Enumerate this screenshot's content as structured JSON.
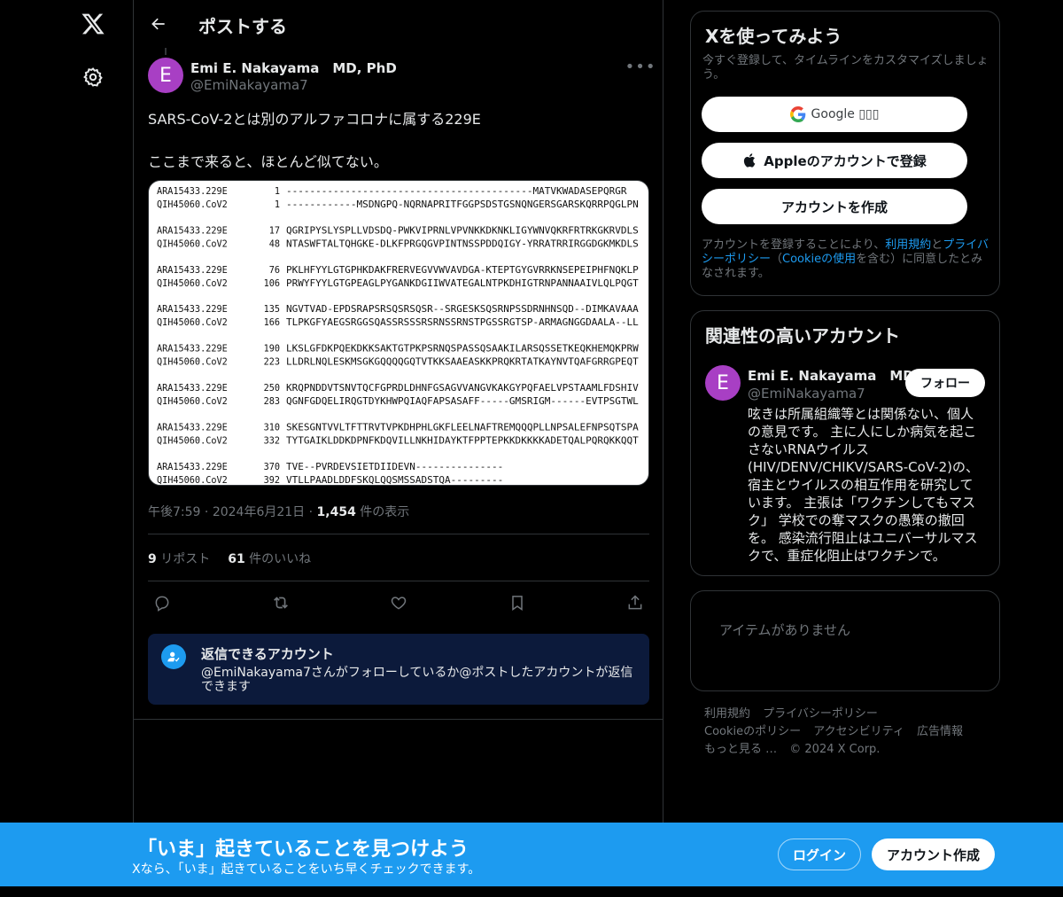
{
  "colors": {
    "accent": "#1d9bf0",
    "background": "#000000",
    "avatar": "#a83fc4",
    "reply_box": "#0c1a3b"
  },
  "nav": {
    "logo_icon": "x-logo-icon",
    "settings_icon": "gear-icon"
  },
  "header": {
    "title": "ポストする",
    "back_icon": "arrow-left-icon"
  },
  "post": {
    "avatar_letter": "E",
    "author_name": "Emi E. Nakayama　MD, PhD",
    "author_handle": "@EmiNakayama7",
    "text_line1": "SARS-CoV-2とは別のアルファコロナに属する229E",
    "text_line2": "ここまで来ると、ほとんど似てない。",
    "time": "午後7:59",
    "date": "2024年6月21日",
    "views_count": "1,454",
    "views_label": "件の表示",
    "reposts_count": "9",
    "reposts_label": "リポスト",
    "likes_count": "61",
    "likes_label": "件のいいね"
  },
  "alignment": {
    "blocks": [
      {
        "rows": [
          {
            "id": "ARA15433.229E",
            "pos": "1",
            "seq": "------------------------------------------MATVKWADASEPQRGR"
          },
          {
            "id": "QIH45060.CoV2",
            "pos": "1",
            "seq": "------------MSDNGPQ-NQRNAPRITFGGPSDSTGSNQNGERSGARSKQRRPQGLPN"
          }
        ]
      },
      {
        "rows": [
          {
            "id": "ARA15433.229E",
            "pos": "17",
            "seq": "QGRIPYSLYSPLLVDSDQ-PWKVIPRNLVPVNKKDKNKLIGYWNVQKRFRTRKGKRVDLS"
          },
          {
            "id": "QIH45060.CoV2",
            "pos": "48",
            "seq": "NTASWFTALTQHGKE-DLKFPRGQGVPINTNSSPDDQIGY-YRRATRRIRGGDGKMKDLS"
          }
        ]
      },
      {
        "rows": [
          {
            "id": "ARA15433.229E",
            "pos": "76",
            "seq": "PKLHFYYLGTGPHKDAKFRERVEGVVWVAVDGA-KTEPTGYGVRRKNSEPEIPHFNQKLP"
          },
          {
            "id": "QIH45060.CoV2",
            "pos": "106",
            "seq": "PRWYFYYLGTGPEAGLPYGANKDGIIWVATEGALNTPKDHIGTRNPANNAAIVLQLPQGT"
          }
        ]
      },
      {
        "rows": [
          {
            "id": "ARA15433.229E",
            "pos": "135",
            "seq": "NGVTVAD-EPDSRAPSRSQSRSQSR--SRGESKSQSRNPSSDRNHNSQD--DIMKAVAAA"
          },
          {
            "id": "QIH45060.CoV2",
            "pos": "166",
            "seq": "TLPKGFYAEGSRGGSQASSRSSSRSRNSSRNSTPGSSRGTSP-ARMAGNGGDAALA--LL"
          }
        ]
      },
      {
        "rows": [
          {
            "id": "ARA15433.229E",
            "pos": "190",
            "seq": "LKSLGFDKPQEKDKKSAKTGTPKPSRNQSPASSQSAAKILARSQSSETKEQKHEMQKPRW"
          },
          {
            "id": "QIH45060.CoV2",
            "pos": "223",
            "seq": "LLDRLNQLESKMSGKGQQQQGQTVTKKSAAEASKKPRQKRTATKAYNVTQAFGRRGPEQT"
          }
        ]
      },
      {
        "rows": [
          {
            "id": "ARA15433.229E",
            "pos": "250",
            "seq": "KRQPNDDVTSNVTQCFGPRDLDHNFGSAGVVANGVKAKGYPQFAELVPSTAAMLFDSHIV"
          },
          {
            "id": "QIH45060.CoV2",
            "pos": "283",
            "seq": "QGNFGDQELIRQGTDYKHWPQIAQFAPSASAFF-----GMSRIGM------EVTPSGTWL"
          }
        ]
      },
      {
        "rows": [
          {
            "id": "ARA15433.229E",
            "pos": "310",
            "seq": "SKESGNTVVLTFTTRVTVPKDHPHLGKFLEELNAFTREMQQQPLLNPSALEFNPSQTSPA"
          },
          {
            "id": "QIH45060.CoV2",
            "pos": "332",
            "seq": "TYTGAIKLDDKDPNFKDQVILLNKHIDAYKTFPPTEPKKDKKKKADETQALPQRQKKQQT"
          }
        ]
      },
      {
        "rows": [
          {
            "id": "ARA15433.229E",
            "pos": "370",
            "seq": "TVE--PVRDEVSIETDIIDEVN---------------"
          },
          {
            "id": "QIH45060.CoV2",
            "pos": "392",
            "seq": "VTLLPAADLDDFSKQLQQSMSSADSTQA---------"
          }
        ]
      }
    ]
  },
  "actions": {
    "reply_icon": "reply-icon",
    "repost_icon": "repost-icon",
    "like_icon": "heart-icon",
    "bookmark_icon": "bookmark-icon",
    "share_icon": "share-icon"
  },
  "reply_restriction": {
    "title": "返信できるアカウント",
    "description": "@EmiNakayama7さんがフォローしているか@ポストしたアカウントが返信できます"
  },
  "signup_card": {
    "title": "Xを使ってみよう",
    "subtitle": "今すぐ登録して、タイムラインをカスタマイズしましょう。",
    "google_label": "Google ▯▯▯",
    "apple_label": "Appleのアカウントで登録",
    "create_label": "アカウントを作成",
    "legal_pre": "アカウントを登録することにより、",
    "legal_terms": "利用規約",
    "legal_and": "と",
    "legal_privacy": "プライバシーポリシー",
    "legal_mid": "（",
    "legal_cookie": "Cookieの使用",
    "legal_post": "を含む）に同意したとみなされます。"
  },
  "related": {
    "title": "関連性の高いアカウント",
    "avatar_letter": "E",
    "name": "Emi E. Nakayama　MD",
    "handle": "@EmiNakayama7",
    "follow_label": "フォロー",
    "bio": "呟きは所属組織等とは関係ない、個人の意見です。 主に人にしか病気を起こさないRNAウイルス(HIV/DENV/CHIKV/SARS-CoV-2)の、宿主とウイルスの相互作用を研究しています。 主張は「ワクチンしてもマスク」 学校での奪マスクの愚策の撤回を。 感染流行阻止はユニバーサルマスクで、重症化阻止はワクチンで。"
  },
  "trends": {
    "empty_label": "アイテムがありません"
  },
  "footer": {
    "links": [
      "利用規約",
      "プライバシーポリシー",
      "Cookieのポリシー",
      "アクセシビリティ",
      "広告情報",
      "もっと見る …",
      "© 2024 X Corp."
    ]
  },
  "banner": {
    "title": "「いま」起きていることを見つけよう",
    "subtitle": "Xなら、「いま」起きていることをいち早くチェックできます。",
    "login_label": "ログイン",
    "signup_label": "アカウント作成"
  }
}
